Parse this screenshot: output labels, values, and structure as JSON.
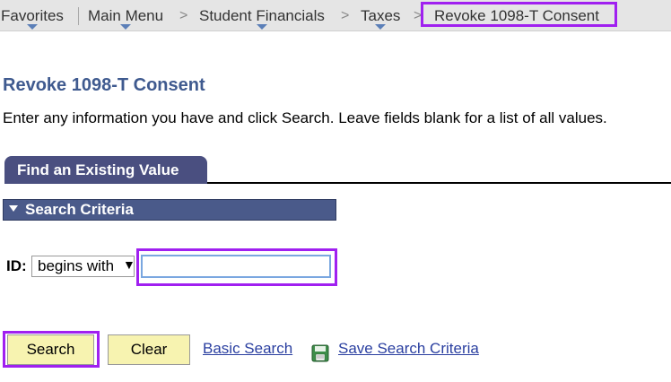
{
  "breadcrumb": {
    "items": [
      "Favorites",
      "Main Menu",
      "Student Financials",
      "Taxes"
    ],
    "separator": ">",
    "current": "Revoke 1098-T Consent"
  },
  "page": {
    "title": "Revoke 1098-T Consent",
    "instructions": "Enter any information you have and click Search. Leave fields blank for a list of all values."
  },
  "tab": {
    "label": "Find an Existing Value"
  },
  "criteria": {
    "label": "Search Criteria"
  },
  "id_field": {
    "label": "ID:",
    "operator": "begins with",
    "value": ""
  },
  "buttons": {
    "search": "Search",
    "clear": "Clear"
  },
  "links": {
    "basic_search": "Basic Search",
    "save_search": "Save Search Criteria"
  },
  "icons": {
    "save": "save-search-icon",
    "dropdown": "chevron-down-icon"
  },
  "colors": {
    "accent": "#4a5a8a",
    "title": "#3f5a8f",
    "button": "#f7f3b0",
    "highlight": "#a020f0",
    "link": "#2a3fa0"
  }
}
